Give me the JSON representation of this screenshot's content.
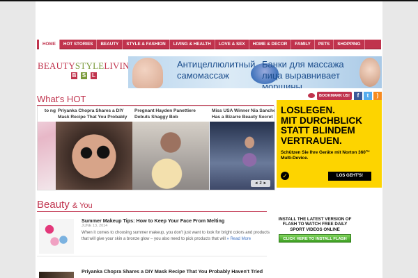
{
  "nav": {
    "items": [
      {
        "label": "HOME"
      },
      {
        "label": "HOT STORIES"
      },
      {
        "label": "BEAUTY"
      },
      {
        "label": "STYLE & FASHION"
      },
      {
        "label": "LIVING & HEALTH"
      },
      {
        "label": "LOVE & SEX"
      },
      {
        "label": "HOME & DECOR"
      },
      {
        "label": "FAMILY"
      },
      {
        "label": "PETS"
      },
      {
        "label": "SHOPPING"
      }
    ],
    "active_index": 0
  },
  "logo": {
    "beauty": "BEAUTY",
    "style": "STYLE",
    "living": "LIVING",
    "letters": [
      {
        "char": "B",
        "color": "#c0334d"
      },
      {
        "char": "S",
        "color": "#7a9a3a"
      },
      {
        "char": "L",
        "color": "#c0334d"
      }
    ]
  },
  "banner_ad": {
    "text_left": "Антицеллюлитный самомассаж",
    "text_right": "Банки для массажа лица выравнивает морщины"
  },
  "whats_hot": {
    "title": "What's HOT",
    "bookmark_label": "BOOKMARK US!",
    "social": {
      "facebook": "f",
      "twitter": "t",
      "rss": ")"
    },
    "slides": [
      {
        "caption": "to ng"
      },
      {
        "caption": "Priyanka Chopra Shares a DIY Mask Recipe That You Probably"
      },
      {
        "caption": "Pregnant Hayden Panettiere Debuts Shaggy Bob"
      },
      {
        "caption": "Miss USA Winner Nia Sanchez Has a Bizarre Beauty Secret"
      }
    ],
    "pager": "◄ 2 ►"
  },
  "norton_ad": {
    "headline_1": "LOSLEGEN.",
    "headline_2": "MIT DURCHBLICK",
    "headline_3": "STATT BLINDEM",
    "headline_4": "VERTRAUEN.",
    "subline": "Schützen Sie Ihre Geräte mit Norton 360™ Multi-Device.",
    "button": "LOS GEHT'S!",
    "check": "✓"
  },
  "beauty_section": {
    "title": "Beauty",
    "amp": "& You",
    "posts": [
      {
        "title": "Summer Makeup Tips: How to Keep Your Face From Melting",
        "date": "JUNE 13, 2014",
        "excerpt": "When it comes to choosing summer makeup, you don't just want to look for bright colors and products that will give your skin a bronze glow – you also need to pick products that will",
        "read_more": "» Read More"
      },
      {
        "title": "Priyanka Chopra Shares a DIY Mask Recipe That You Probably Haven't Tried"
      }
    ]
  },
  "flash_ad": {
    "text": "INSTALL THE LATEST VERSION OF FLASH TO WATCH FREE DAILY SPORT VIDEOS ONLINE",
    "button": "CLICK HERE TO INSTALL FLASH"
  }
}
